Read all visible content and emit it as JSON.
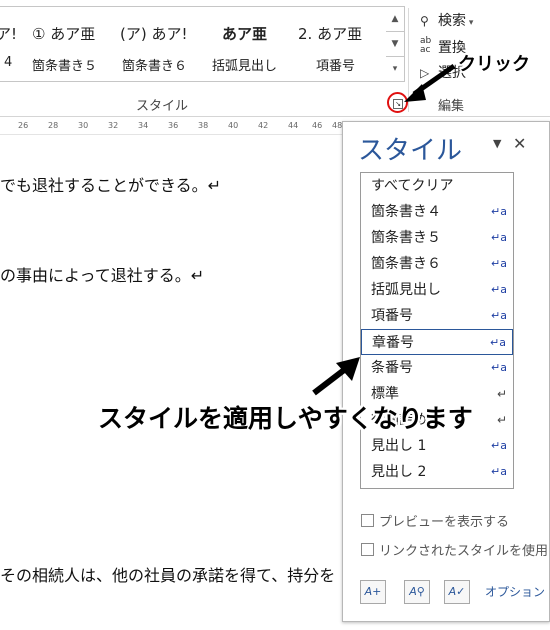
{
  "ribbon": {
    "gallery_big": [
      "ア!",
      "① あア亜",
      "(ア) あア!",
      "あア亜",
      "2. あア亜"
    ],
    "gallery_small": [
      "4",
      "箇条書き５",
      "箇条書き６",
      "括弧見出し",
      "項番号"
    ],
    "group_label_styles": "スタイル",
    "group_label_edit": "編集",
    "launcher_symbol": "↘",
    "edit": {
      "search": "検索",
      "replace": "置換",
      "select": "選択"
    }
  },
  "ruler": {
    "labels": [
      "26",
      "28",
      "30",
      "32",
      "34",
      "36",
      "38",
      "40",
      "42",
      "44",
      "46",
      "48"
    ]
  },
  "document": {
    "lines": [
      "でも退社することができる。↵",
      "の事由によって退社する。↵",
      "その相続人は、他の社員の承諾を得て、持分を"
    ]
  },
  "styles_pane": {
    "title": "スタイル",
    "dropdown_icon": "▼",
    "close_icon": "✕",
    "items": [
      {
        "label": "すべてクリア",
        "mark": ""
      },
      {
        "label": "箇条書き４",
        "mark": "↵a"
      },
      {
        "label": "箇条書き５",
        "mark": "↵a"
      },
      {
        "label": "箇条書き６",
        "mark": "↵a"
      },
      {
        "label": "括弧見出し",
        "mark": "↵a"
      },
      {
        "label": "項番号",
        "mark": "↵a"
      },
      {
        "label": "章番号",
        "mark": "↵a"
      },
      {
        "label": "条番号",
        "mark": "↵a"
      },
      {
        "label": "標準",
        "mark": "↵"
      },
      {
        "label": "行間詰め",
        "mark": "↵"
      },
      {
        "label": "見出し 1",
        "mark": "↵a"
      },
      {
        "label": "見出し 2",
        "mark": "↵a"
      }
    ],
    "selected_index": 6,
    "checkbox_preview": "プレビューを表示する",
    "checkbox_linked": "リンクされたスタイルを使用不",
    "options": "オプション"
  },
  "annotations": {
    "click_label": "クリック",
    "callout": "スタイルを適用しやすくなります",
    "circle_color": "#e01010"
  }
}
